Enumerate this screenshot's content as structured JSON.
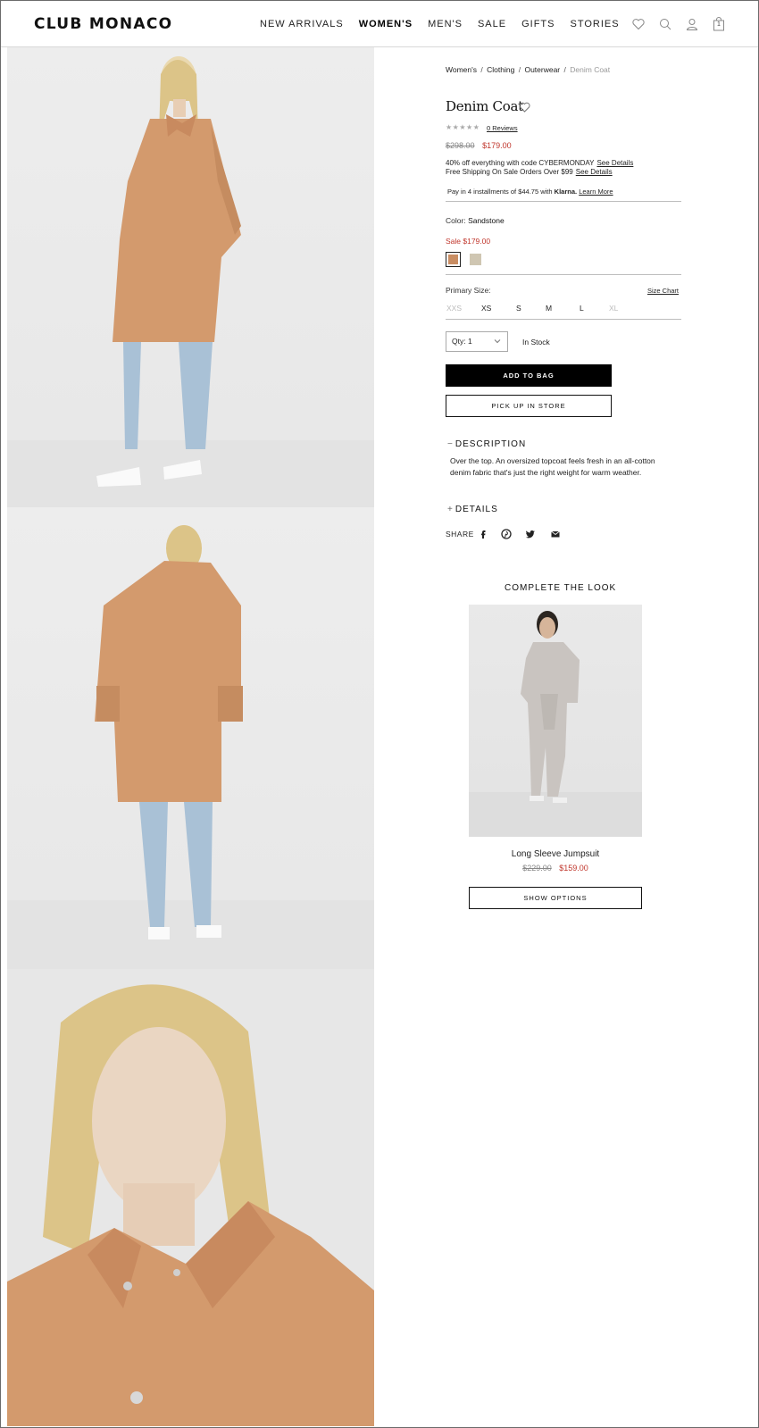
{
  "header": {
    "logo": "CLUB MONACO",
    "nav": [
      "NEW ARRIVALS",
      "WOMEN'S",
      "MEN'S",
      "SALE",
      "GIFTS",
      "STORIES"
    ],
    "active_nav": "WOMEN'S",
    "icons": [
      "heart-icon",
      "search-icon",
      "account-icon",
      "bag-icon"
    ],
    "bag_count": "1"
  },
  "breadcrumb": {
    "items": [
      "Women's",
      "Clothing",
      "Outerwear"
    ],
    "current": "Denim Coat",
    "separator": "/"
  },
  "product": {
    "name": "Denim Coat",
    "stars": "★★★★★",
    "reviews": "0 Reviews",
    "price_original": "$298.00",
    "price_sale": "$179.00",
    "promo_line1": "40% off everything with code CYBERMONDAY",
    "promo_line1_link": "See Details",
    "promo_line2": "Free Shipping On Sale Orders Over $99",
    "promo_line2_link": "See Details",
    "klarna_text": "Pay in 4 installments of $44.75 with",
    "klarna_brand": "Klarna.",
    "klarna_link": "Learn More",
    "color_label": "Color:",
    "color_value": "Sandstone",
    "color_sale_price": "Sale $179.00",
    "swatches": [
      {
        "name": "Sandstone",
        "hex": "#c98d62",
        "selected": true
      },
      {
        "name": "Light",
        "hex": "#cfc6b2",
        "selected": false
      }
    ],
    "size_label": "Primary Size:",
    "size_chart": "Size Chart",
    "sizes": [
      {
        "label": "XXS",
        "available": false
      },
      {
        "label": "XS",
        "available": true
      },
      {
        "label": "S",
        "available": true
      },
      {
        "label": "M",
        "available": true
      },
      {
        "label": "L",
        "available": true
      },
      {
        "label": "XL",
        "available": false
      }
    ],
    "qty_label": "Qty: 1",
    "stock": "In Stock",
    "add_to_bag": "ADD TO BAG",
    "pick_up": "PICK UP IN STORE",
    "description_heading": "DESCRIPTION",
    "description_sign": "−",
    "description": "Over the top. An oversized topcoat feels fresh in an all-cotton denim fabric that's just the right weight for warm weather.",
    "details_heading": "DETAILS",
    "details_sign": "+",
    "share_label": "SHARE",
    "share_icons": [
      "facebook-icon",
      "pinterest-icon",
      "twitter-icon",
      "email-icon"
    ]
  },
  "complete_the_look": {
    "title": "COMPLETE THE LOOK",
    "item_name": "Long Sleeve Jumpsuit",
    "price_original": "$229.00",
    "price_sale": "$159.00",
    "button": "SHOW OPTIONS"
  },
  "colors": {
    "sale_red": "#c0362c",
    "coat": "#d39a6d",
    "jeans": "#a9c1d6"
  }
}
